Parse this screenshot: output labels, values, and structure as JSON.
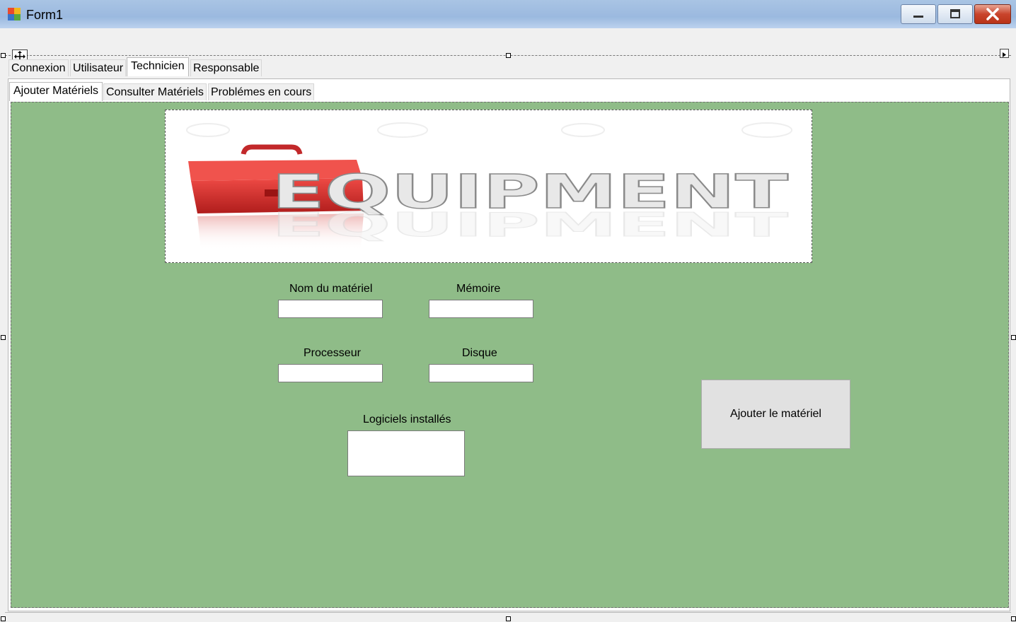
{
  "window": {
    "title": "Form1",
    "buttons": {
      "minimize": "minimize",
      "maximize": "maximize",
      "close": "close"
    }
  },
  "main_tabs": [
    "Connexion",
    "Utilisateur",
    "Technicien",
    "Responsable"
  ],
  "main_tabs_selected": "Technicien",
  "sub_tabs": [
    "Ajouter Matériels",
    "Consulter Matériels",
    "Problémes en cours"
  ],
  "sub_tabs_selected": "Ajouter Matériels",
  "banner": {
    "text": "EQUIPMENT"
  },
  "form": {
    "nom_label": "Nom du matériel",
    "nom_value": "",
    "memoire_label": "Mémoire",
    "memoire_value": "",
    "processeur_label": "Processeur",
    "processeur_value": "",
    "disque_label": "Disque",
    "disque_value": "",
    "logiciels_label": "Logiciels installés",
    "logiciels_value": "",
    "submit_label": "Ajouter le matériel"
  },
  "colors": {
    "tab_background": "#8fbc88",
    "button": "#e1e1e1",
    "toolbox_red": "#d8322f"
  }
}
